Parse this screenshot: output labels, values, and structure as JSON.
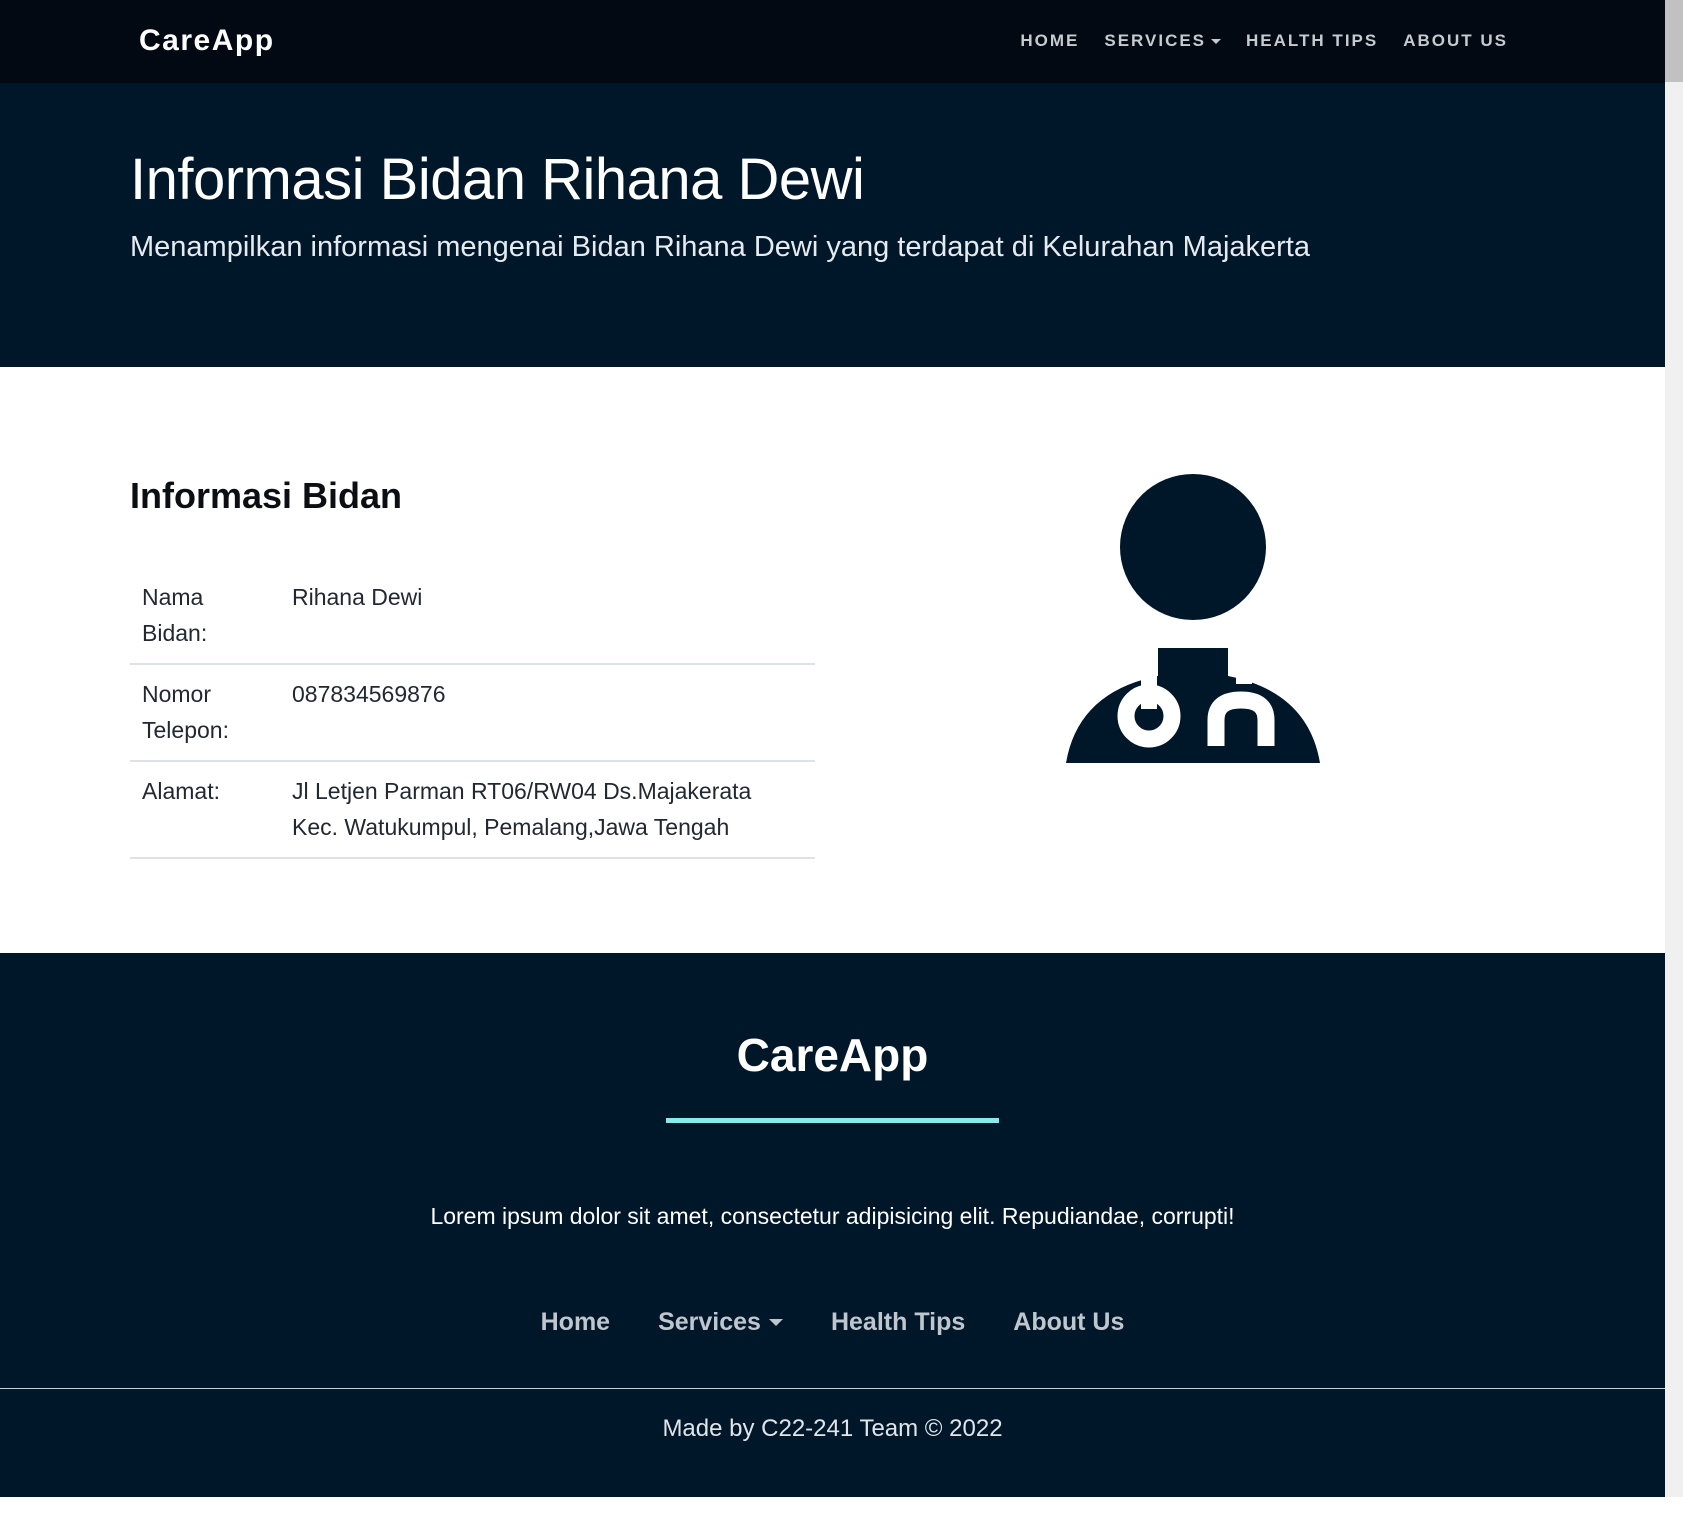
{
  "navbar": {
    "brand": "CareApp",
    "links": {
      "home": "Home",
      "services": "Services",
      "health_tips": "Health Tips",
      "about_us": "About Us"
    }
  },
  "hero": {
    "title": "Informasi Bidan Rihana Dewi",
    "subtitle": "Menampilkan informasi mengenai Bidan Rihana Dewi yang terdapat di Kelurahan Majakerta"
  },
  "info": {
    "section_title": "Informasi Bidan",
    "rows": [
      {
        "label": "Nama Bidan:",
        "value": "Rihana Dewi"
      },
      {
        "label": "Nomor Telepon:",
        "value": "087834569876"
      },
      {
        "label": "Alamat:",
        "value": "Jl Letjen Parman RT06/RW04 Ds.Majakerata Kec. Watukumpul, Pemalang,Jawa Tengah"
      }
    ],
    "image_icon": "user-doctor-icon"
  },
  "footer": {
    "brand": "CareApp",
    "text": "Lorem ipsum dolor sit amet, consectetur adipisicing elit. Repudiandae, corrupti!",
    "links": {
      "home": "Home",
      "services": "Services",
      "health_tips": "Health Tips",
      "about_us": "About Us"
    },
    "copyright": "Made by C22-241 Team © 2022"
  },
  "colors": {
    "navbar_bg": "#020912",
    "primary_dark": "#001629",
    "accent": "#8aeaea"
  }
}
